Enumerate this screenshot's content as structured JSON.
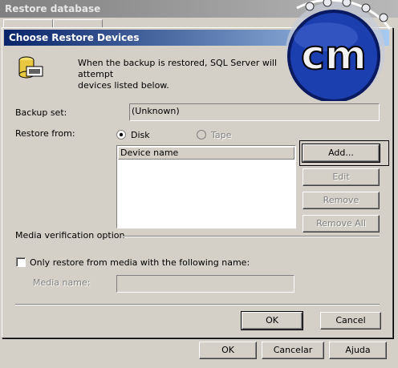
{
  "background_window": {
    "title": "Restore database",
    "buttons": {
      "ok": "OK",
      "cancel": "Cancelar",
      "help": "Ajuda"
    }
  },
  "dialog": {
    "title": "Choose Restore Devices",
    "info_line1": "When the backup is restored, SQL Server will attempt",
    "info_line2": "devices listed below.",
    "backup_set_label": "Backup set:",
    "backup_set_value": "(Unknown)",
    "restore_from_label": "Restore from:",
    "disk_label": "Disk",
    "tape_label": "Tape",
    "device_name_header": "Device name",
    "buttons": {
      "add": "Add...",
      "edit": "Edit",
      "remove": "Remove",
      "remove_all": "Remove All",
      "ok": "OK",
      "cancel": "Cancel"
    },
    "media_verification_label": "Media verification option",
    "only_restore_label": "Only restore from media with the following name:",
    "media_name_label": "Media name:",
    "media_name_value": ""
  },
  "watermark": {
    "text": "cm"
  },
  "colors": {
    "title_active": "#0a246a",
    "title_inactive": "#808080",
    "face": "#d4d0c8",
    "logo_blue": "#1c3fb0"
  }
}
